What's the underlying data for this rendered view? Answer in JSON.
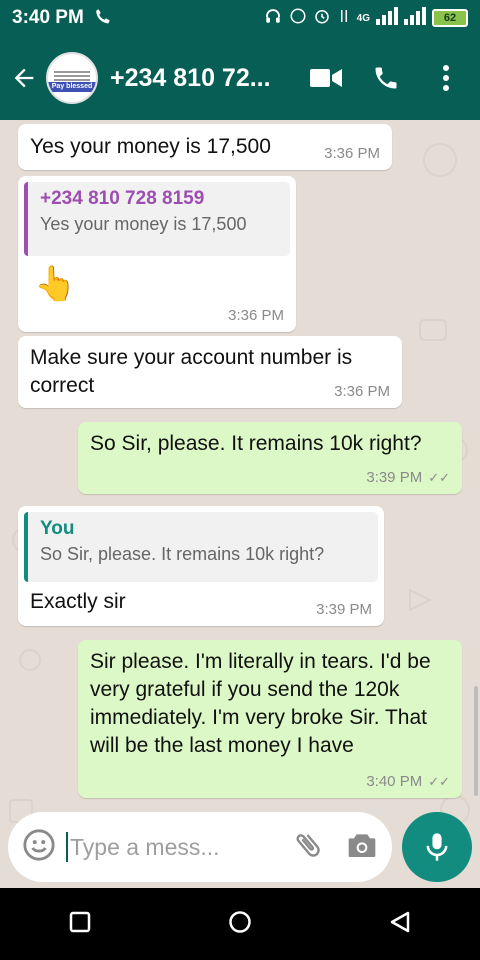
{
  "status_bar": {
    "time": "3:40 PM",
    "network": "4G",
    "battery": "62"
  },
  "header": {
    "contact": "+234 810 72...",
    "avatar_banner": "Pay blessed",
    "icons": [
      "back-arrow-icon",
      "video-call-icon",
      "phone-icon",
      "more-vert-icon"
    ]
  },
  "messages": [
    {
      "direction": "in",
      "text": "Yes your money is 17,500",
      "time": "3:36 PM"
    },
    {
      "direction": "in",
      "quote_sender": "+234 810 728 8159",
      "quote_text": "Yes your money is 17,500",
      "emoji": "👆",
      "time": "3:36 PM"
    },
    {
      "direction": "in",
      "text": "Make sure your account number is correct",
      "time": "3:36 PM"
    },
    {
      "direction": "out",
      "text": "So Sir, please. It remains 10k right?",
      "time": "3:39 PM"
    },
    {
      "direction": "in",
      "quote_sender": "You",
      "quote_text": "So Sir, please. It remains 10k right?",
      "text": "Exactly sir",
      "time": "3:39 PM"
    },
    {
      "direction": "out",
      "text": "Sir please. I'm literally in tears. I'd be very grateful if you send the 120k immediately. I'm very broke Sir. That will be the last money I have",
      "time": "3:40 PM"
    }
  ],
  "composer": {
    "placeholder": "Type a mess..."
  },
  "colors": {
    "header": "#075e54",
    "outgoing_bubble": "#dcf8c6",
    "chat_bg": "#e5ddd5",
    "mic": "#128c7e",
    "quote_purple": "#9c4fb0",
    "quote_green": "#128c7e"
  }
}
